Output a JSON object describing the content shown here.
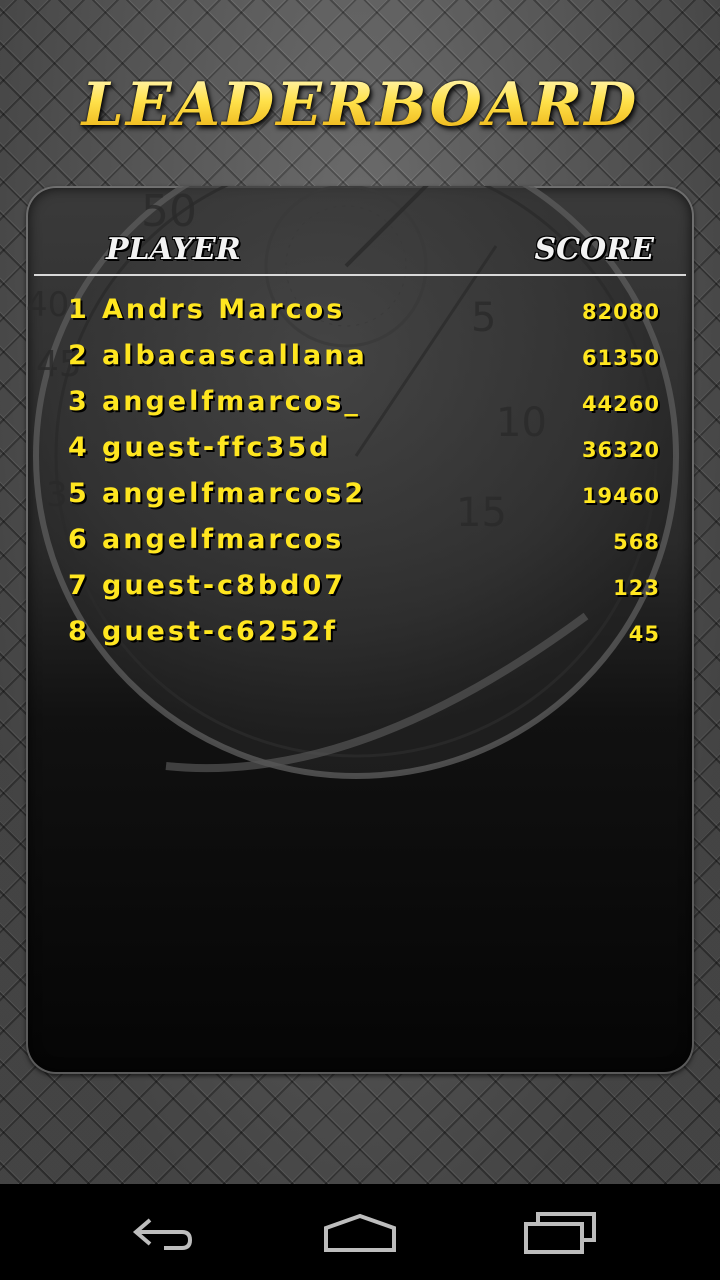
{
  "title": "LEADERBOARD",
  "headers": {
    "player": "PLAYER",
    "score": "SCORE"
  },
  "leaderboard": [
    {
      "rank": "1",
      "name": "Andrs Marcos",
      "score": "82080"
    },
    {
      "rank": "2",
      "name": "albacascallana",
      "score": "61350"
    },
    {
      "rank": "3",
      "name": "angelfmarcos_",
      "score": "44260"
    },
    {
      "rank": "4",
      "name": "guest-ffc35d",
      "score": "36320"
    },
    {
      "rank": "5",
      "name": "angelfmarcos2",
      "score": "19460"
    },
    {
      "rank": "6",
      "name": "angelfmarcos",
      "score": "568"
    },
    {
      "rank": "7",
      "name": "guest-c8bd07",
      "score": "123"
    },
    {
      "rank": "8",
      "name": "guest-c6252f",
      "score": "45"
    }
  ],
  "navbar": {
    "icons": [
      "back-icon",
      "home-icon",
      "recent-apps-icon"
    ]
  },
  "colors": {
    "accent": "#ffe620",
    "header_text": "#f2f2f2",
    "panel": "#1a1a1a"
  }
}
